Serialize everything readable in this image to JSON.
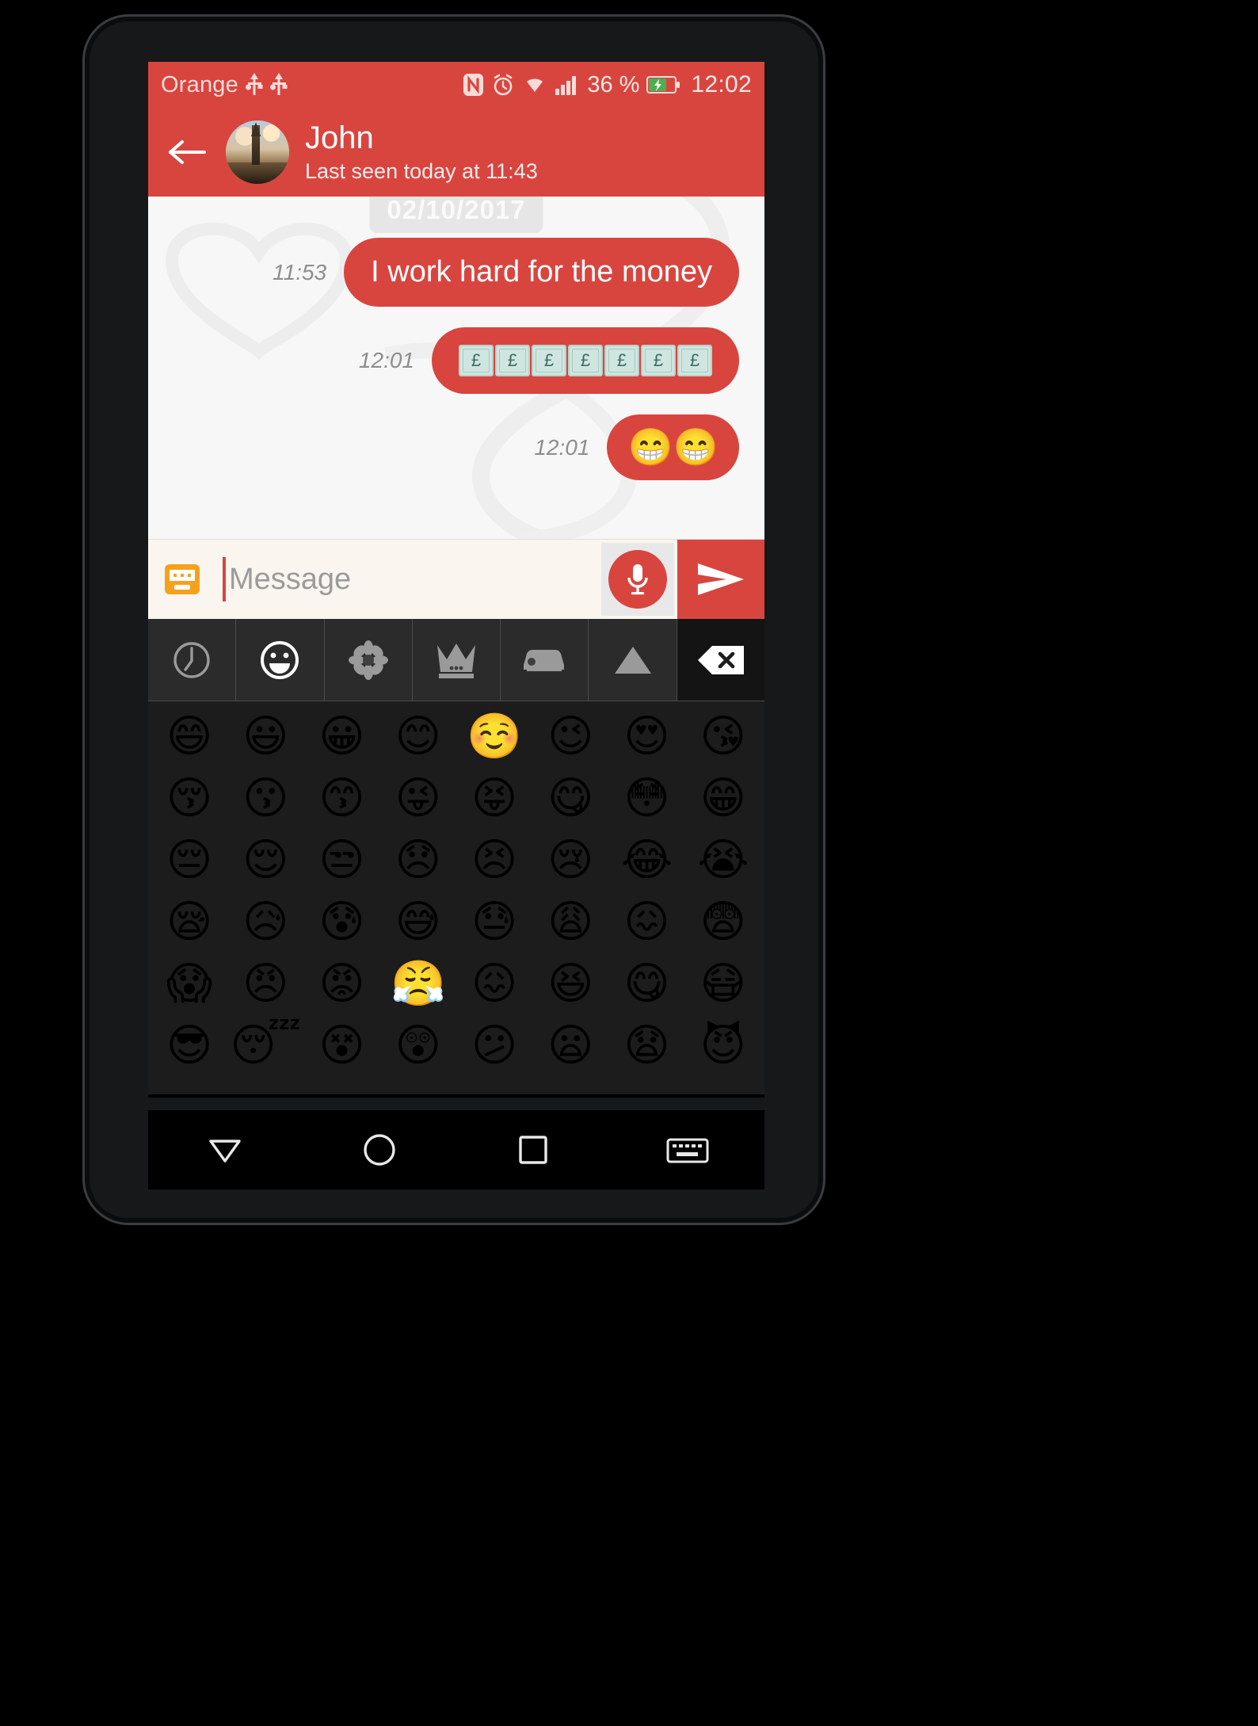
{
  "status_bar": {
    "carrier": "Orange",
    "icons": [
      "usb-icon",
      "usb-icon",
      "nfc-icon",
      "alarm-icon",
      "wifi-icon",
      "signal-icon"
    ],
    "battery_percent": "36 %",
    "clock": "12:02"
  },
  "app_bar": {
    "back_icon": "back-arrow-icon",
    "avatar": "contact-avatar-big-ben",
    "contact_name": "John",
    "contact_status": "Last seen today at 11:43"
  },
  "chat": {
    "date_chip": "02/10/2017",
    "messages": [
      {
        "time": "11:53",
        "type": "text",
        "text": "I work hard for the money",
        "outgoing": true
      },
      {
        "time": "12:01",
        "type": "money",
        "text": "£££££££",
        "notes": 7,
        "note_symbol": "£",
        "outgoing": true
      },
      {
        "time": "12:01",
        "type": "emoji",
        "text": "😁😁",
        "outgoing": true
      }
    ]
  },
  "input_bar": {
    "keyboard_icon": "keyboard-icon",
    "placeholder": "Message",
    "value": "",
    "mic_icon": "microphone-icon",
    "send_icon": "send-icon"
  },
  "emoji_keyboard": {
    "tabs": [
      {
        "name": "recent",
        "icon": "clock-icon",
        "active": false
      },
      {
        "name": "smileys",
        "icon": "smiley-icon",
        "active": true
      },
      {
        "name": "nature",
        "icon": "flower-icon",
        "active": false
      },
      {
        "name": "objects",
        "icon": "crown-icon",
        "active": false
      },
      {
        "name": "travel",
        "icon": "car-icon",
        "active": false
      },
      {
        "name": "symbols",
        "icon": "triangle-icon",
        "active": false
      },
      {
        "name": "backspace",
        "icon": "backspace-icon",
        "active": false
      }
    ],
    "emojis": [
      "😄",
      "😃",
      "😀",
      "😊",
      "☺️",
      "😉",
      "😍",
      "😘",
      "😚",
      "😗",
      "😙",
      "😜",
      "😝",
      "😋",
      "😳",
      "😁",
      "😔",
      "😌",
      "😒",
      "😞",
      "😣",
      "😢",
      "😂",
      "😭",
      "😪",
      "😥",
      "😰",
      "😅",
      "😓",
      "😩",
      "😖",
      "😨",
      "😱",
      "😠",
      "😡",
      "😤",
      "😖",
      "😆",
      "😋",
      "😷",
      "😎",
      "😴",
      "😵",
      "😲",
      "😕",
      "😦",
      "😧",
      "😈"
    ]
  },
  "nav_bar": {
    "buttons": [
      {
        "name": "back",
        "icon": "triangle-down-icon"
      },
      {
        "name": "home",
        "icon": "circle-icon"
      },
      {
        "name": "recents",
        "icon": "square-icon"
      },
      {
        "name": "keyboard-toggle",
        "icon": "keyboard-icon"
      }
    ]
  },
  "colors": {
    "accent_red": "#d8453f",
    "chat_bg": "#f7f7f7",
    "input_bg": "#faf6ef",
    "keyboard_bg": "#1c1c1c"
  }
}
